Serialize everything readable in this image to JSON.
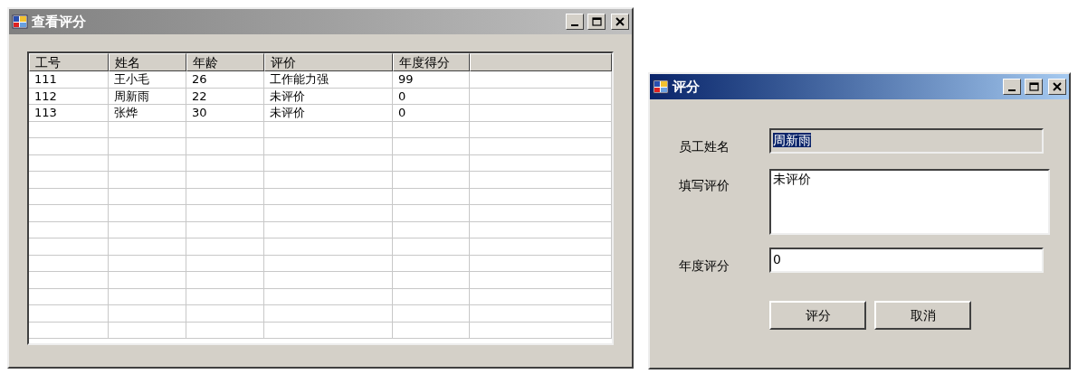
{
  "windows": [
    {
      "title": "查看评分",
      "active": false,
      "table": {
        "columns": [
          "工号",
          "姓名",
          "年龄",
          "评价",
          "年度得分"
        ],
        "rows": [
          [
            "111",
            "王小毛",
            "26",
            "工作能力强",
            "99"
          ],
          [
            "112",
            "周新雨",
            "22",
            "未评价",
            "0"
          ],
          [
            "113",
            "张烨",
            "30",
            "未评价",
            "0"
          ]
        ]
      }
    },
    {
      "title": "评分",
      "active": true,
      "fields": [
        {
          "label": "员工姓名",
          "kind": "textbox",
          "value": "周新雨",
          "readonly": true,
          "text_selected": true
        },
        {
          "label": "填写评价",
          "kind": "textarea",
          "value": "未评价",
          "readonly": false,
          "text_selected": false
        },
        {
          "label": "年度评分",
          "kind": "textbox",
          "value": "0",
          "readonly": false,
          "text_selected": false
        }
      ],
      "buttons": [
        "评分",
        "取消"
      ]
    }
  ]
}
